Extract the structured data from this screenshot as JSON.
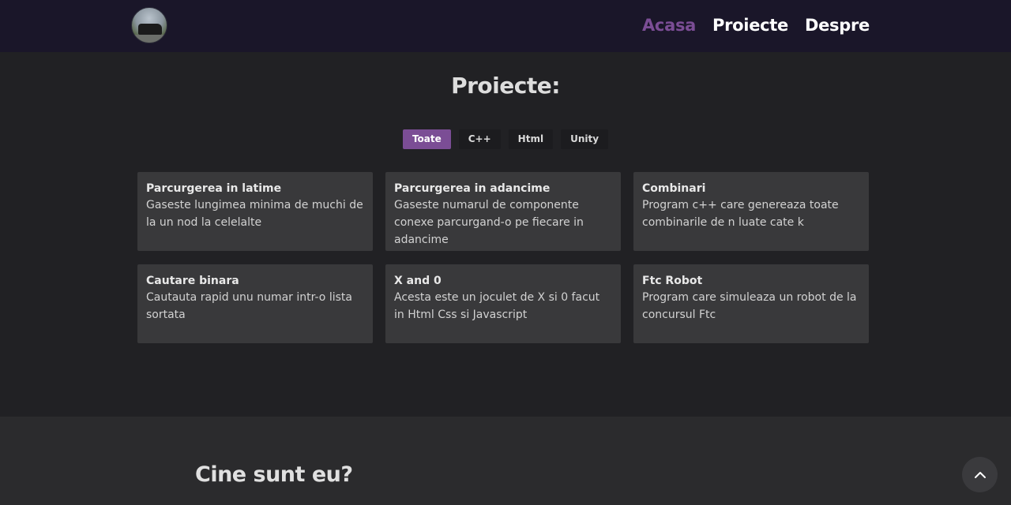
{
  "nav": {
    "links": [
      "Acasa",
      "Proiecte",
      "Despre"
    ]
  },
  "projects": {
    "title": "Proiecte:",
    "filters": [
      "Toate",
      "C++",
      "Html",
      "Unity"
    ],
    "active_filter": "Toate",
    "cards": [
      {
        "title": "Parcurgerea in latime",
        "desc": "Gaseste lungimea minima de muchi de la un nod la celelalte"
      },
      {
        "title": "Parcurgerea in adancime",
        "desc": "Gaseste numarul de componente conexe parcurgand-o pe fiecare in adancime"
      },
      {
        "title": "Combinari",
        "desc": "Program c++ care genereaza toate combinarile de n luate cate k"
      },
      {
        "title": "Cautare binara",
        "desc": "Cautauta rapid unu numar intr-o lista sortata"
      },
      {
        "title": "X and 0",
        "desc": "Acesta este un joculet de X si 0 facut in Html Css si Javascript"
      },
      {
        "title": "Ftc Robot",
        "desc": "Program care simuleaza un robot de la concursul Ftc"
      }
    ]
  },
  "about": {
    "title": "Cine sunt eu?"
  },
  "icons": {
    "scroll_top": "chevron-up-icon"
  },
  "colors": {
    "accent": "#7b4d95",
    "navbar": "#1a1629",
    "background": "#212124",
    "card": "#39393b"
  }
}
